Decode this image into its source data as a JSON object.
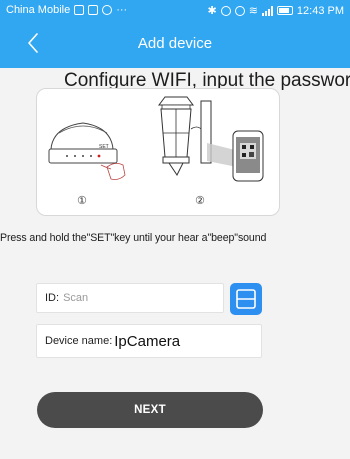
{
  "status_bar": {
    "carrier": "China Mobile",
    "time": "12:43 PM"
  },
  "header": {
    "title": "Add device"
  },
  "configure_text": "Configure WIFI, input the password.",
  "illustration": {
    "step1_number": "①",
    "step2_number": "②",
    "device_set_label": "SET"
  },
  "instruction": "Press and hold the\"SET\"key until your hear a\"beep\"sound",
  "form": {
    "id_label": "ID:",
    "id_placeholder": "Scan",
    "device_name_label": "Device name:",
    "device_name_value": "IpCamera"
  },
  "next_button": {
    "label": "NEXT"
  },
  "colors": {
    "accent": "#31a7f1",
    "scan_button": "#2d8ff0",
    "next_button": "#4b4b4b",
    "background": "#f3f3f3"
  }
}
